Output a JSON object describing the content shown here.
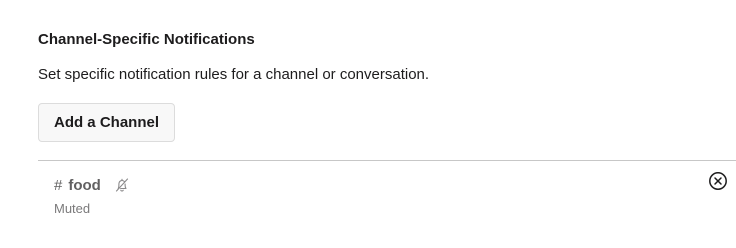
{
  "section": {
    "title": "Channel-Specific Notifications",
    "description": "Set specific notification rules for a channel or conversation."
  },
  "actions": {
    "add_channel_label": "Add a Channel"
  },
  "channels": [
    {
      "prefix": "#",
      "name": "food",
      "status": "Muted",
      "muted_icon": "bell-slash-icon",
      "remove_icon": "circle-x-icon"
    }
  ],
  "colors": {
    "text_primary": "#1d1c1d",
    "text_secondary": "#616061",
    "text_muted": "#7b7a7b",
    "button_bg": "#f8f8f8",
    "divider": "#c7c7c7"
  }
}
